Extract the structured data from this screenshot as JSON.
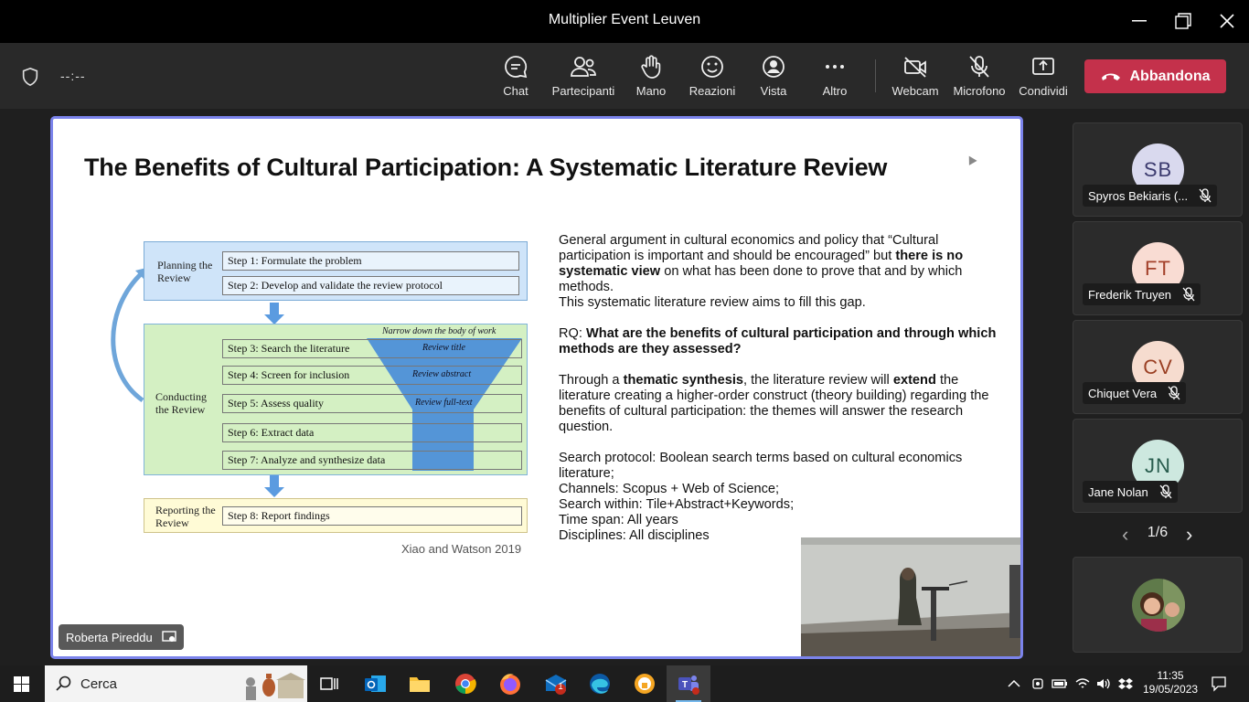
{
  "window": {
    "title": "Multiplier Event Leuven"
  },
  "toolbar": {
    "timer": "--:--",
    "buttons": [
      {
        "label": "Chat",
        "icon": "chat-icon"
      },
      {
        "label": "Partecipanti",
        "icon": "participants-icon"
      },
      {
        "label": "Mano",
        "icon": "raise-hand-icon"
      },
      {
        "label": "Reazioni",
        "icon": "reactions-icon"
      },
      {
        "label": "Vista",
        "icon": "view-icon"
      },
      {
        "label": "Altro",
        "icon": "more-icon"
      },
      {
        "label": "Webcam",
        "icon": "camera-off-icon"
      },
      {
        "label": "Microfono",
        "icon": "mic-off-icon"
      },
      {
        "label": "Condividi",
        "icon": "share-icon"
      }
    ],
    "leave_label": "Abbandona",
    "leave_color": "#c4314b"
  },
  "slide": {
    "title": "The Benefits of Cultural Participation: A Systematic Literature Review",
    "diagram": {
      "phases": [
        "Planning the Review",
        "Conducting the Review",
        "Reporting the Review"
      ],
      "steps": [
        "Step 1: Formulate the problem",
        "Step 2: Develop and validate the review protocol",
        "Step 3: Search the literature",
        "Step 4: Screen for inclusion",
        "Step 5: Assess quality",
        "Step 6: Extract data",
        "Step 7: Analyze and synthesize data",
        "Step 8: Report findings"
      ],
      "funnel_labels": [
        "Narrow down the body of work",
        "Review title",
        "Review abstract",
        "Review full-text"
      ]
    },
    "citation": "Xiao and Watson 2019",
    "para1_a": "General argument in cultural economics and policy that “Cultural participation is important and should be encouraged” but ",
    "para1_b": "there is no systematic view",
    "para1_c": " on what has been done to prove that and by which methods.",
    "para1_d": "This systematic literature review aims to fill this gap.",
    "rq_prefix": "RQ: ",
    "rq": "What are the benefits of cultural participation and through which methods are they assessed?",
    "para3_a": "Through a ",
    "para3_b": "thematic synthesis",
    "para3_c": ", the literature review will ",
    "para3_d": "extend",
    "para3_e": " the literature creating a higher-order construct (theory building) regarding the benefits of cultural participation: the themes will answer the research question.",
    "protocol": [
      "Search protocol: Boolean search terms based on cultural economics literature;",
      "Channels: Scopus + Web of Science;",
      "Search within: Tile+Abstract+Keywords;",
      "Time span: All years",
      "Disciplines: All disciplines"
    ]
  },
  "presenter": {
    "name": "Roberta Pireddu"
  },
  "participants": [
    {
      "initials": "SB",
      "name": "Spyros Bekiaris (...",
      "bg": "#d9d9ee",
      "fg": "#3b3a6e"
    },
    {
      "initials": "FT",
      "name": "Frederik Truyen",
      "bg": "#f9dcd3",
      "fg": "#a3402a"
    },
    {
      "initials": "CV",
      "name": "Chiquet Vera",
      "bg": "#f6dccf",
      "fg": "#9a3f23"
    },
    {
      "initials": "JN",
      "name": "Jane Nolan",
      "bg": "#cde8df",
      "fg": "#285c4d"
    }
  ],
  "pager": "1/6",
  "taskbar": {
    "search_label": "Cerca",
    "time": "11:35",
    "date": "19/05/2023",
    "mail_badge": "1"
  }
}
